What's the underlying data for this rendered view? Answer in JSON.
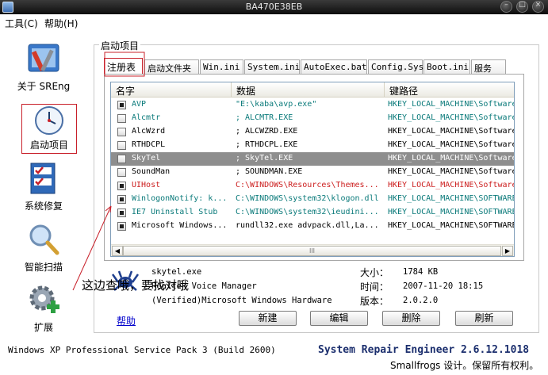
{
  "window": {
    "title": "BA470E38EB",
    "min_label": "–",
    "max_label": "□",
    "close_label": "×"
  },
  "menu": [
    {
      "label": "工具(C)"
    },
    {
      "label": "帮助(H)"
    }
  ],
  "nav": [
    {
      "label": "关于 SREng",
      "icon": "tools-icon"
    },
    {
      "label": "启动项目",
      "icon": "clock-icon",
      "selected": true
    },
    {
      "label": "系统修复",
      "icon": "checklist-icon"
    },
    {
      "label": "智能扫描",
      "icon": "magnifier-icon"
    },
    {
      "label": "扩展",
      "icon": "gear-plus-icon"
    }
  ],
  "group_label": "启动项目",
  "tabs": [
    {
      "label": "注册表",
      "active": true
    },
    {
      "label": "启动文件夹"
    },
    {
      "label": "Win.ini"
    },
    {
      "label": "System.ini"
    },
    {
      "label": "AutoExec.bat"
    },
    {
      "label": "Config.Sys"
    },
    {
      "label": "Boot.ini"
    },
    {
      "label": "服务"
    }
  ],
  "list": {
    "columns": [
      "名字",
      "数据",
      "键路径"
    ],
    "rows": [
      {
        "checked": true,
        "name": "AVP",
        "data": "\"E:\\kaba\\avp.exe\"",
        "path": "HKEY_LOCAL_MACHINE\\Software",
        "color": "#0a7a7a",
        "selected": false
      },
      {
        "checked": false,
        "name": "Alcmtr",
        "data": "; ALCMTR.EXE",
        "path": "HKEY_LOCAL_MACHINE\\Software",
        "color": "#0a7a7a",
        "selected": false
      },
      {
        "checked": false,
        "name": "AlcWzrd",
        "data": "; ALCWZRD.EXE",
        "path": "HKEY_LOCAL_MACHINE\\Software",
        "color": "#000000",
        "selected": false
      },
      {
        "checked": false,
        "name": "RTHDCPL",
        "data": "; RTHDCPL.EXE",
        "path": "HKEY_LOCAL_MACHINE\\Software",
        "color": "#000000",
        "selected": false
      },
      {
        "checked": false,
        "name": "SkyTel",
        "data": "; SkyTel.EXE",
        "path": "HKEY_LOCAL_MACHINE\\Software",
        "color": "#ffffff",
        "selected": true
      },
      {
        "checked": false,
        "name": "SoundMan",
        "data": "; SOUNDMAN.EXE",
        "path": "HKEY_LOCAL_MACHINE\\Software",
        "color": "#000000",
        "selected": false
      },
      {
        "checked": true,
        "name": "UIHost",
        "data": "C:\\WINDOWS\\Resources\\Themes...",
        "path": "HKEY_LOCAL_MACHINE\\Software",
        "color": "#cc1f1f",
        "selected": false
      },
      {
        "checked": true,
        "name": "WinlogonNotify: k...",
        "data": "C:\\WINDOWS\\system32\\klogon.dll",
        "path": "HKEY_LOCAL_MACHINE\\SOFTWARE",
        "color": "#0a7a7a",
        "selected": false
      },
      {
        "checked": true,
        "name": "IE7 Uninstall Stub",
        "data": "C:\\WINDOWS\\system32\\ieudini...",
        "path": "HKEY_LOCAL_MACHINE\\SOFTWARE",
        "color": "#0a7a7a",
        "selected": false
      },
      {
        "checked": true,
        "name": "Microsoft Windows...",
        "data": "rundll32.exe advpack.dll,La...",
        "path": "HKEY_LOCAL_MACHINE\\SOFTWARE",
        "color": "#000000",
        "selected": false
      }
    ],
    "scroll_thumb": "III"
  },
  "details": {
    "file": "skytel.exe",
    "desc": "Realtek Voice Manager",
    "company": "(Verified)Microsoft Windows Hardware",
    "size_label": "大小：",
    "size_value": "1784 KB",
    "time_label": "时间：",
    "time_value": "2007-11-20 18:15",
    "version_label": "版本：",
    "version_value": "2.0.2.0"
  },
  "buttons": {
    "help": "帮助",
    "new": "新建",
    "edit": "编辑",
    "delete": "删除",
    "refresh": "刷新"
  },
  "annotation": "这边查哦，要找对哦",
  "status": {
    "os": "Windows XP Professional Service Pack 3 (Build 2600)",
    "product": "System Repair Engineer 2.6.12.1018",
    "copyright": "Smallfrogs 设计。保留所有权利。"
  },
  "colors": {
    "accent_red": "#c8202a",
    "link_blue": "#0000cc",
    "teal": "#0a7a7a"
  }
}
